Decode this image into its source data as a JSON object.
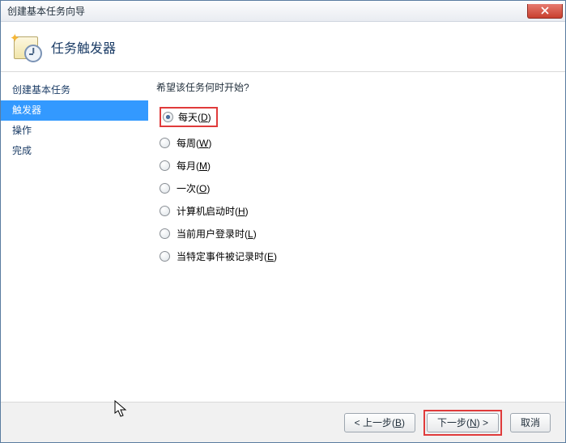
{
  "window": {
    "title": "创建基本任务向导"
  },
  "header": {
    "title": "任务触发器"
  },
  "sidebar": {
    "items": [
      {
        "label": "创建基本任务"
      },
      {
        "label": "触发器"
      },
      {
        "label": "操作"
      },
      {
        "label": "完成"
      }
    ],
    "active_index": 1
  },
  "main": {
    "question": "希望该任务何时开始?",
    "options": [
      {
        "text": "每天",
        "accel": "D",
        "selected": true,
        "highlighted": true
      },
      {
        "text": "每周",
        "accel": "W",
        "selected": false,
        "highlighted": false
      },
      {
        "text": "每月",
        "accel": "M",
        "selected": false,
        "highlighted": false
      },
      {
        "text": "一次",
        "accel": "O",
        "selected": false,
        "highlighted": false
      },
      {
        "text": "计算机启动时",
        "accel": "H",
        "selected": false,
        "highlighted": false
      },
      {
        "text": "当前用户登录时",
        "accel": "L",
        "selected": false,
        "highlighted": false
      },
      {
        "text": "当特定事件被记录时",
        "accel": "E",
        "selected": false,
        "highlighted": false
      }
    ]
  },
  "footer": {
    "back": {
      "prefix": "< 上一步(",
      "accel": "B",
      "suffix": ")"
    },
    "next": {
      "prefix": "下一步(",
      "accel": "N",
      "suffix": ") >",
      "highlighted": true
    },
    "cancel": "取消"
  }
}
